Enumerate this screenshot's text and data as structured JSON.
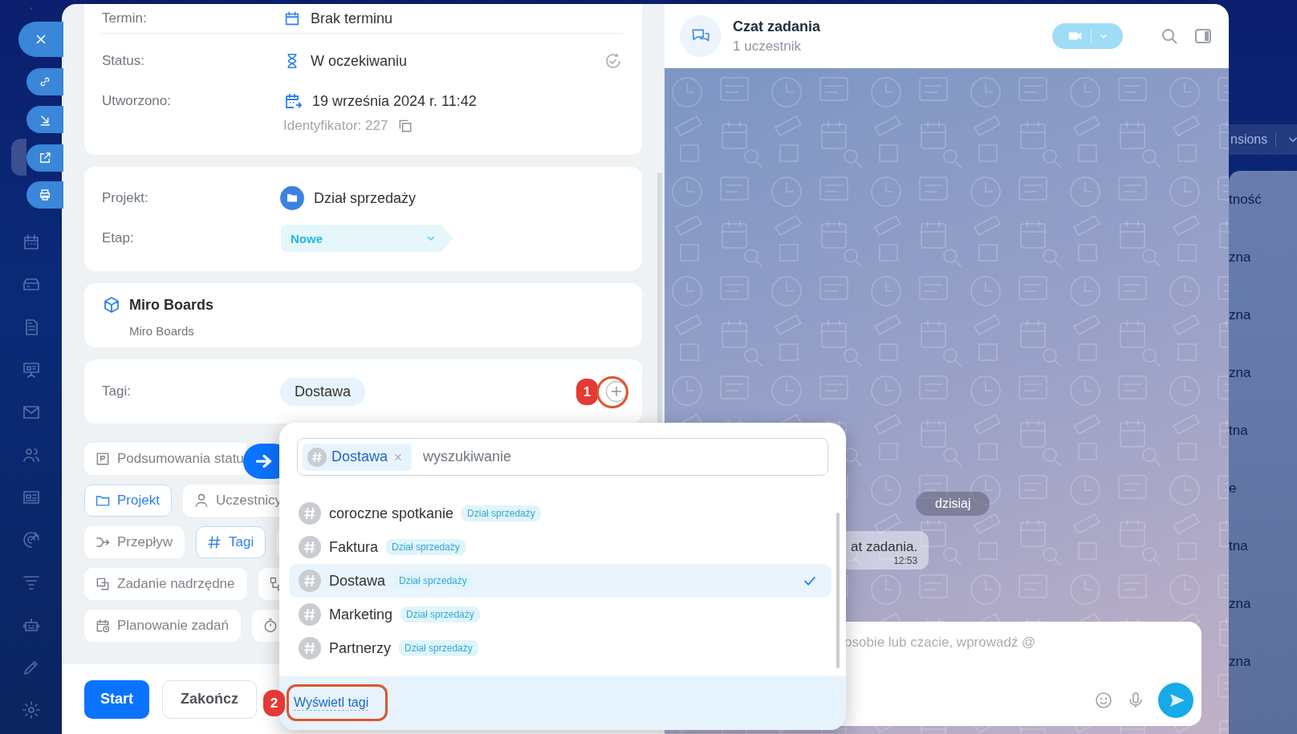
{
  "sidebar": {
    "items": [
      {
        "selected": false
      },
      {
        "selected": false
      },
      {
        "selected": true
      },
      {
        "selected": false
      },
      {
        "selected": false
      },
      {
        "selected": false
      },
      {
        "selected": false
      },
      {
        "selected": false
      },
      {
        "selected": false
      },
      {
        "selected": false
      },
      {
        "selected": false
      },
      {
        "selected": false
      },
      {
        "selected": false
      },
      {
        "selected": false
      },
      {
        "selected": false
      },
      {
        "selected": false
      }
    ]
  },
  "task": {
    "deadline": {
      "label": "Termin:",
      "value": "Brak terminu"
    },
    "status": {
      "label": "Status:",
      "value": "W oczekiwaniu"
    },
    "created": {
      "label": "Utworzono:",
      "value": "19 września 2024 r. 11:42",
      "identifier": "Identyfikator: 227"
    },
    "project": {
      "label": "Projekt:",
      "value": "Dział sprzedaży"
    },
    "stage": {
      "label": "Etap:",
      "value": "Nowe"
    },
    "app": {
      "title": "Miro Boards",
      "subtitle": "Miro Boards"
    },
    "tags": {
      "label": "Tagi:",
      "items": [
        "Dostawa"
      ],
      "step_badge": "1"
    },
    "field_chips": [
      [
        {
          "label": "Podsumowania statu",
          "selected": false
        }
      ],
      [
        {
          "label": "Projekt",
          "selected": true
        },
        {
          "label": "Uczestnicy",
          "selected": false
        }
      ],
      [
        {
          "label": "Przepływ",
          "selected": false
        },
        {
          "label": "Tagi",
          "selected": true
        },
        {
          "selected": false
        }
      ],
      [
        {
          "label": "Zadanie nadrzędne",
          "selected": false
        },
        {
          "selected": false
        }
      ],
      [
        {
          "label": "Planowanie zadań",
          "selected": false
        },
        {
          "selected": false
        }
      ]
    ],
    "buttons": [
      {
        "label": "Start",
        "kind": "primary"
      },
      {
        "label": "Zakończ",
        "kind": "secondary"
      }
    ]
  },
  "tag_picker": {
    "tokens": [
      "Dostawa"
    ],
    "placeholder": "wyszukiwanie",
    "options": [
      {
        "name": "coroczne spotkanie",
        "project": "Dział sprzedaży",
        "selected": false
      },
      {
        "name": "Faktura",
        "project": "Dział sprzedaży",
        "selected": false
      },
      {
        "name": "Dostawa",
        "project": "Dział sprzedaży",
        "selected": true
      },
      {
        "name": "Marketing",
        "project": "Dział sprzedaży",
        "selected": false
      },
      {
        "name": "Partnerzy",
        "project": "Dział sprzedaży",
        "selected": false
      }
    ],
    "footer_link": "Wyświetl tagi",
    "step_badge": "2"
  },
  "chat": {
    "title": "Czat zadania",
    "subtitle": "1 uczestnik",
    "date_pill": "dzisiaj",
    "message": {
      "text": "at zadania.",
      "time": "12:53"
    },
    "composer_placeholder": "osobie lub czacie, wprowadź @"
  },
  "background": {
    "toolbar_button": "nsions",
    "rows": [
      "tność",
      "zna",
      "zna",
      "zna",
      "tna",
      "e",
      "tna",
      "zna",
      "zna"
    ]
  }
}
